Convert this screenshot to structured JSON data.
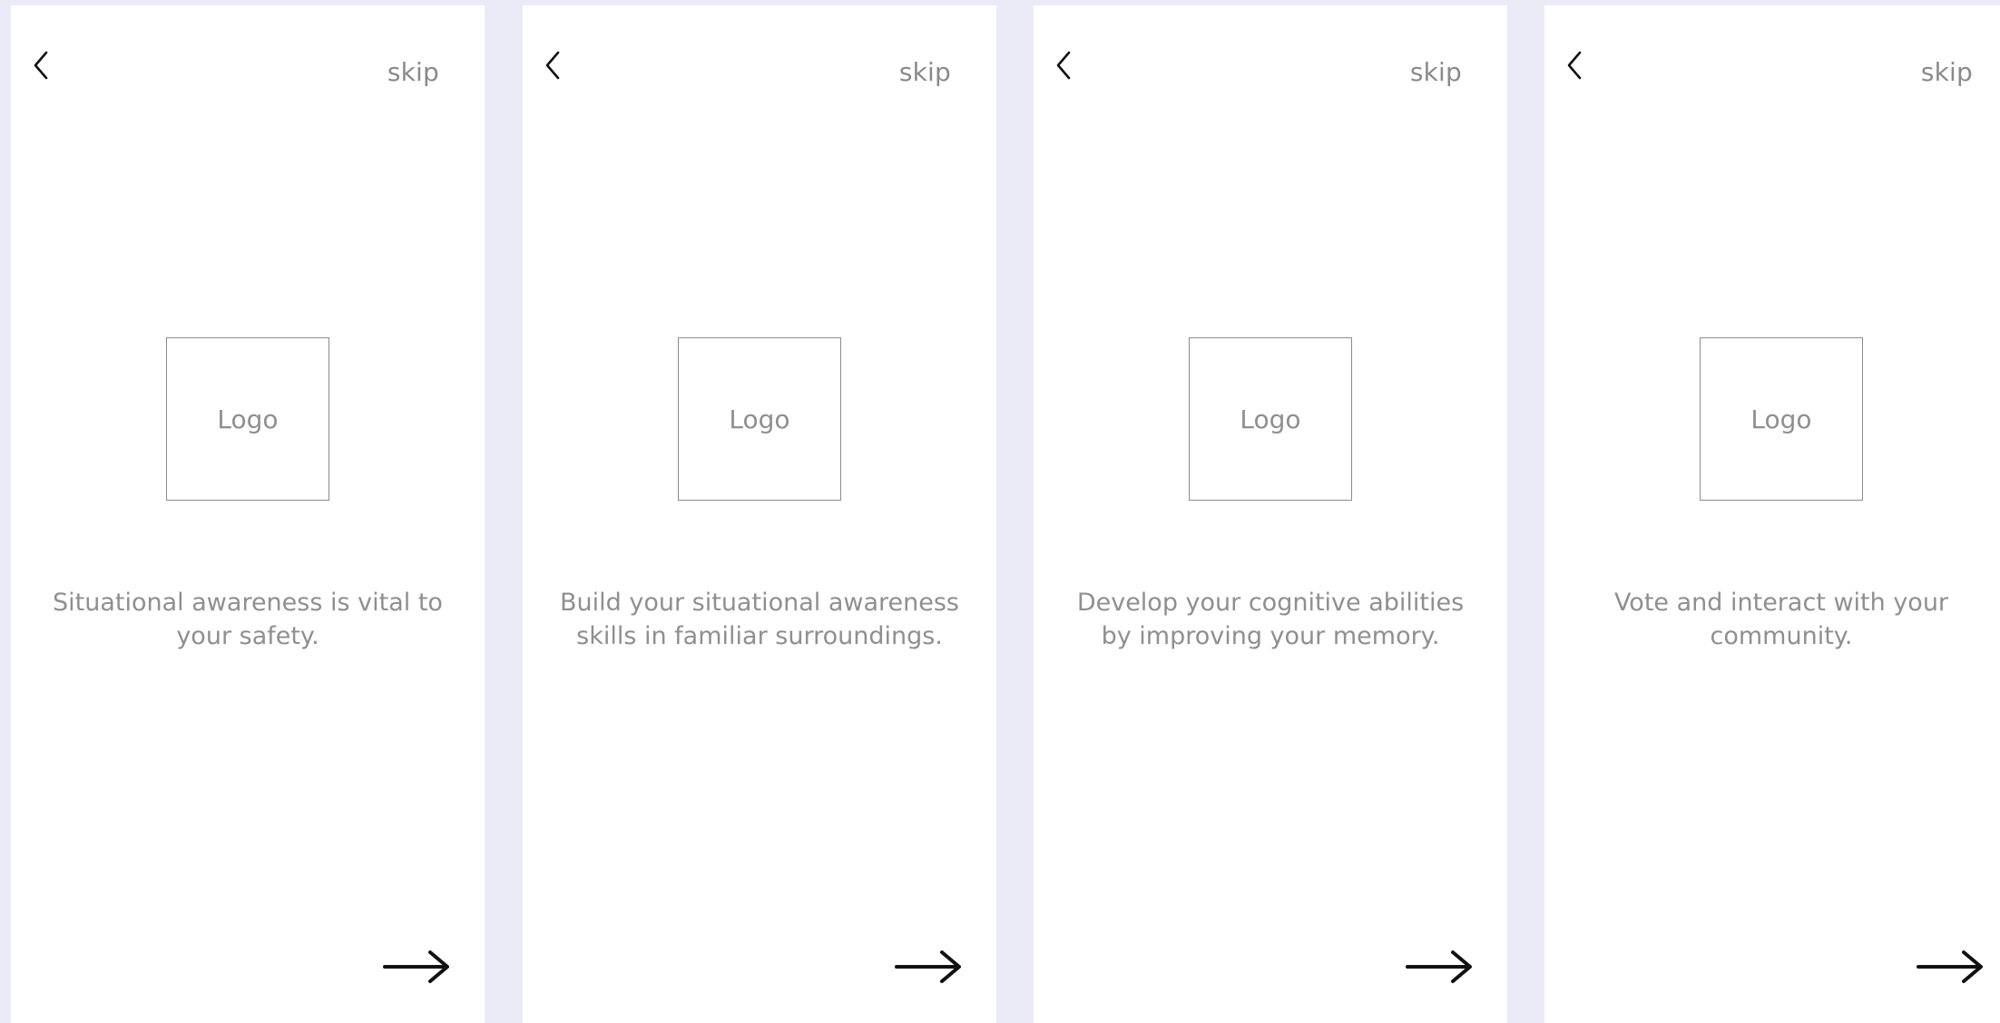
{
  "screens": [
    {
      "back_icon": "chevron-left-icon",
      "skip_label": "skip",
      "logo_label": "Logo",
      "description": "Situational awareness is vital to your safety.",
      "next_icon": "arrow-right-icon"
    },
    {
      "back_icon": "chevron-left-icon",
      "skip_label": "skip",
      "logo_label": "Logo",
      "description": "Build your situational awareness skills in familiar surroundings.",
      "next_icon": "arrow-right-icon"
    },
    {
      "back_icon": "chevron-left-icon",
      "skip_label": "skip",
      "logo_label": "Logo",
      "description": "Develop your cognitive abilities by improving your memory.",
      "next_icon": "arrow-right-icon"
    },
    {
      "back_icon": "chevron-left-icon",
      "skip_label": "skip",
      "logo_label": "Logo",
      "description": "Vote and interact with your community.",
      "next_icon": "arrow-right-icon"
    }
  ],
  "colors": {
    "canvas_background": "#ebebf8",
    "screen_background": "#ffffff",
    "secondary_text": "#8f8f8f",
    "icon_stroke": "#111111"
  }
}
